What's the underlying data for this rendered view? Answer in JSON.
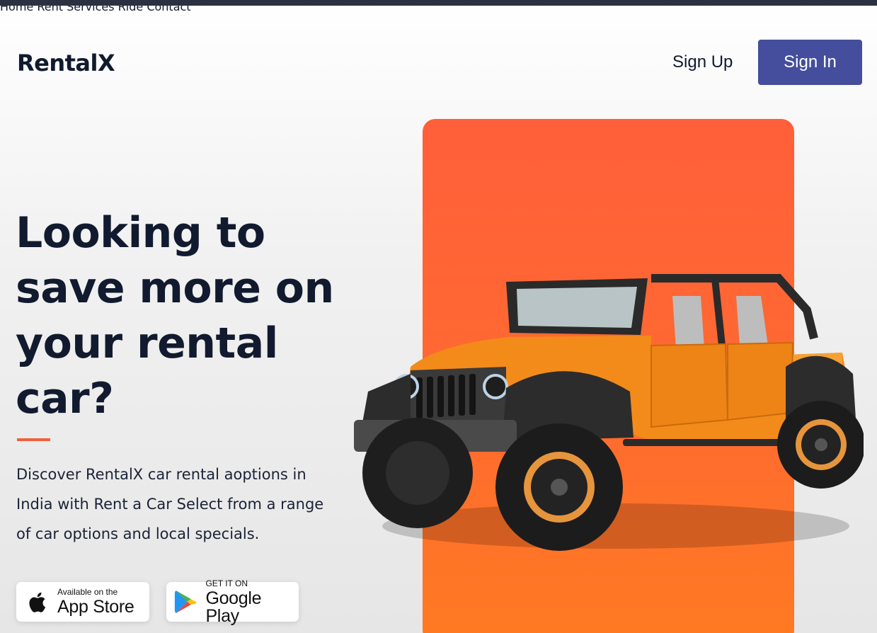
{
  "header": {
    "logo": "RentalX",
    "nav": [
      {
        "label": "Home"
      },
      {
        "label": "Rent"
      },
      {
        "label": "Services"
      },
      {
        "label": "Ride"
      },
      {
        "label": "Contact"
      }
    ],
    "sign_up": "Sign Up",
    "sign_in": "Sign In"
  },
  "hero": {
    "headline_lines": [
      "Looking to",
      "save more on",
      "your rental",
      "car?"
    ],
    "description_lines": [
      "Discover RentalX car rental aoptions in",
      "India with Rent a Car Select from a range",
      "of car options and local specials."
    ]
  },
  "badges": {
    "apple": {
      "small": "Available on the",
      "big": "App Store"
    },
    "google": {
      "small": "GET IT ON",
      "big": "Google Play"
    }
  },
  "colors": {
    "accent": "#f2603b",
    "button": "#444e9c",
    "panel": "#ff6a30",
    "text": "#111a2e"
  },
  "icons": [
    "apple-icon",
    "google-play-icon"
  ],
  "image": "orange-jeep-photo"
}
